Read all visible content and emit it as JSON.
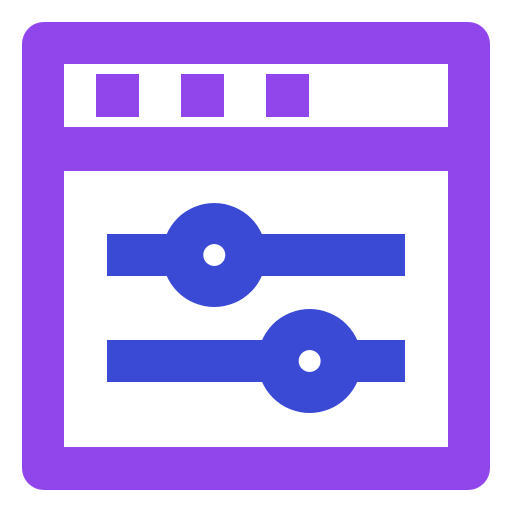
{
  "icon": {
    "name": "browser-settings-sliders-icon",
    "colors": {
      "frame": "#9146EB",
      "sliders": "#3A4AD4",
      "background": "#FFFFFF"
    },
    "title_bar": {
      "dots": [
        "window-dot",
        "window-dot",
        "window-dot"
      ]
    },
    "sliders": [
      {
        "name": "slider-top",
        "level": 0.36
      },
      {
        "name": "slider-bottom",
        "level": 0.68
      }
    ]
  }
}
